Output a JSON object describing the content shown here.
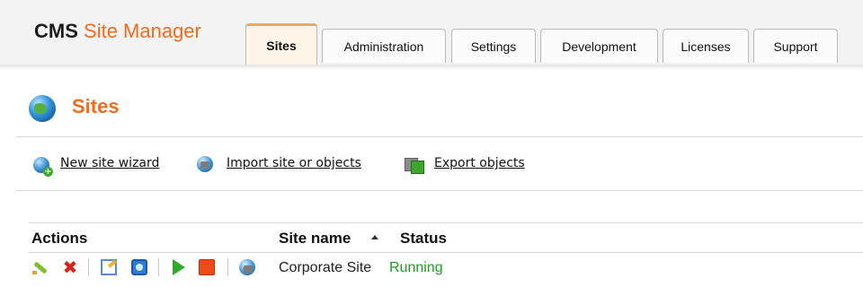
{
  "header": {
    "logo_bold": "CMS",
    "logo_rest": "Site Manager",
    "tabs": [
      {
        "label": "Sites",
        "active": true
      },
      {
        "label": "Administration",
        "active": false
      },
      {
        "label": "Settings",
        "active": false
      },
      {
        "label": "Development",
        "active": false
      },
      {
        "label": "Licenses",
        "active": false
      },
      {
        "label": "Support",
        "active": false
      }
    ]
  },
  "page": {
    "title": "Sites",
    "title_icon": "globe-icon"
  },
  "actions": [
    {
      "label": "New site wizard",
      "icon": "new-site-globe-icon"
    },
    {
      "label": "Import site or objects",
      "icon": "import-globe-icon"
    },
    {
      "label": "Export objects",
      "icon": "export-boxes-icon"
    }
  ],
  "table": {
    "columns": [
      "Actions",
      "Site name",
      "Status"
    ],
    "sort_column": "Site name",
    "sort_direction": "ascending",
    "rows": [
      {
        "action_icons": [
          "edit-icon",
          "delete-icon",
          "properties-icon",
          "preview-icon",
          "start-icon",
          "stop-icon",
          "export-site-icon"
        ],
        "site_name": "Corporate Site",
        "status": "Running"
      }
    ]
  },
  "colors": {
    "accent_orange": "#f26b1d",
    "status_running": "#1d9e1d",
    "active_tab_bg": "#fff4e8"
  }
}
